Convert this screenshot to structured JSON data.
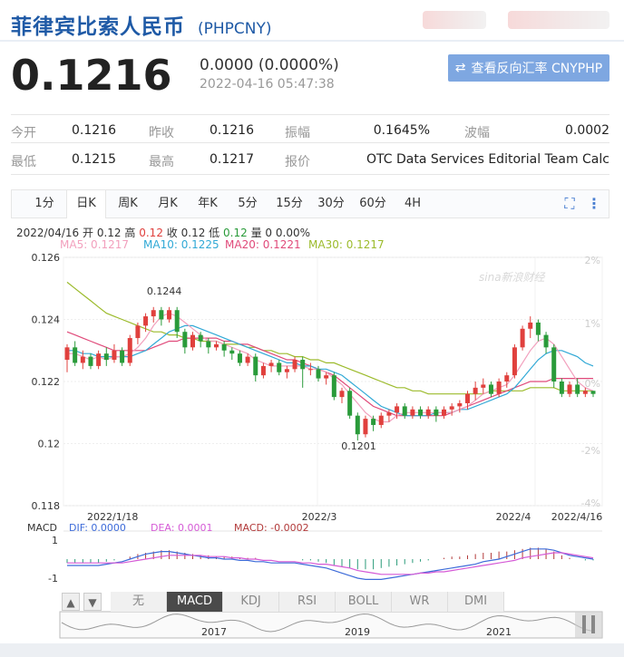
{
  "header": {
    "title": "菲律宾比索人民币",
    "code": "(PHPCNY)"
  },
  "quote": {
    "price": "0.1216",
    "change": "0.0000 (0.0000%)",
    "timestamp": "2022-04-16 05:47:38"
  },
  "reverse_button": {
    "icon": "swap-icon",
    "label": "查看反向汇率 CNYPHP"
  },
  "stats": {
    "open_label": "今开",
    "open": "0.1216",
    "prev_close_label": "昨收",
    "prev_close": "0.1216",
    "amplitude_label": "振幅",
    "amplitude": "0.1645%",
    "wave_label": "波幅",
    "wave": "0.0002",
    "low_label": "最低",
    "low": "0.1215",
    "high_label": "最高",
    "high": "0.1217",
    "quote_label": "报价",
    "quote_source": "OTC Data Services Editorial Team Calc..."
  },
  "tabs": [
    "1分",
    "日K",
    "周K",
    "月K",
    "年K",
    "5分",
    "15分",
    "30分",
    "60分",
    "4H"
  ],
  "active_tab": "日K",
  "ohlc": {
    "date": "2022/04/16",
    "open_label": "开",
    "open": "0.12",
    "high_label": "高",
    "high": "0.12",
    "close_label": "收",
    "close": "0.12",
    "low_label": "低",
    "low": "0.12",
    "vol_label": "量",
    "vol": "0",
    "pct": "0.00%"
  },
  "ma": {
    "ma5": "MA5: 0.1217",
    "ma10": "MA10: 0.1225",
    "ma20": "MA20: 0.1221",
    "ma30": "MA30: 0.1217",
    "colors": {
      "ma5": "#f2a0bd",
      "ma10": "#31a9d6",
      "ma20": "#e04a7a",
      "ma30": "#9cbb2c"
    }
  },
  "watermark": "sina新浪财经",
  "chart_data": {
    "type": "candlestick",
    "y_ticks": [
      "0.126",
      "0.124",
      "0.122",
      "0.12",
      "0.118"
    ],
    "y_right_ticks": [
      "2%",
      "1%",
      "0%",
      "-2%",
      "-4%"
    ],
    "x_labels": [
      "2022/1/18",
      "2022/3",
      "2022/4",
      "2022/4/16"
    ],
    "ylim": [
      0.118,
      0.126
    ],
    "annotations": [
      "0.1244",
      "0.1201"
    ],
    "candles": [
      [
        0.1227,
        0.1231,
        0.1223,
        0.1232
      ],
      [
        0.1231,
        0.1226,
        0.1225,
        0.1233
      ],
      [
        0.1226,
        0.1228,
        0.1224,
        0.123
      ],
      [
        0.1228,
        0.1225,
        0.1224,
        0.1229
      ],
      [
        0.1225,
        0.1229,
        0.1224,
        0.123
      ],
      [
        0.1229,
        0.1227,
        0.1225,
        0.1231
      ],
      [
        0.1227,
        0.123,
        0.1226,
        0.1232
      ],
      [
        0.123,
        0.1226,
        0.1225,
        0.1231
      ],
      [
        0.1226,
        0.1234,
        0.1225,
        0.1235
      ],
      [
        0.1234,
        0.1238,
        0.1232,
        0.1239
      ],
      [
        0.1238,
        0.1241,
        0.1236,
        0.1242
      ],
      [
        0.1241,
        0.1243,
        0.1239,
        0.1244
      ],
      [
        0.1243,
        0.124,
        0.1238,
        0.1244
      ],
      [
        0.124,
        0.1243,
        0.1239,
        0.1244
      ],
      [
        0.1243,
        0.1236,
        0.1234,
        0.1244
      ],
      [
        0.1236,
        0.1231,
        0.1229,
        0.1237
      ],
      [
        0.1231,
        0.1235,
        0.123,
        0.1236
      ],
      [
        0.1235,
        0.1233,
        0.1231,
        0.1236
      ],
      [
        0.1233,
        0.1231,
        0.1229,
        0.1234
      ],
      [
        0.1231,
        0.1232,
        0.123,
        0.1233
      ],
      [
        0.1232,
        0.123,
        0.1228,
        0.1233
      ],
      [
        0.123,
        0.1229,
        0.1227,
        0.1231
      ],
      [
        0.1229,
        0.1226,
        0.1225,
        0.123
      ],
      [
        0.1226,
        0.1228,
        0.1225,
        0.1229
      ],
      [
        0.1228,
        0.1222,
        0.122,
        0.1229
      ],
      [
        0.1222,
        0.1225,
        0.1221,
        0.1226
      ],
      [
        0.1225,
        0.1226,
        0.1223,
        0.1227
      ],
      [
        0.1226,
        0.1223,
        0.1222,
        0.1227
      ],
      [
        0.1223,
        0.1224,
        0.1221,
        0.1225
      ],
      [
        0.1224,
        0.1227,
        0.1223,
        0.1228
      ],
      [
        0.1227,
        0.1224,
        0.1218,
        0.1228
      ],
      [
        0.1224,
        0.1224,
        0.1222,
        0.1226
      ],
      [
        0.1224,
        0.1221,
        0.122,
        0.1225
      ],
      [
        0.1221,
        0.1222,
        0.1219,
        0.1223
      ],
      [
        0.1222,
        0.1215,
        0.1214,
        0.1223
      ],
      [
        0.1215,
        0.1217,
        0.1213,
        0.1218
      ],
      [
        0.1217,
        0.1209,
        0.1208,
        0.1218
      ],
      [
        0.1209,
        0.1203,
        0.1201,
        0.121
      ],
      [
        0.1203,
        0.1208,
        0.1202,
        0.1209
      ],
      [
        0.1208,
        0.1206,
        0.1204,
        0.1209
      ],
      [
        0.1206,
        0.1209,
        0.1205,
        0.121
      ],
      [
        0.1209,
        0.121,
        0.1207,
        0.1211
      ],
      [
        0.121,
        0.1212,
        0.1208,
        0.1213
      ],
      [
        0.1212,
        0.1209,
        0.1208,
        0.1213
      ],
      [
        0.1209,
        0.1211,
        0.1208,
        0.1212
      ],
      [
        0.1211,
        0.1209,
        0.1208,
        0.1212
      ],
      [
        0.1209,
        0.1211,
        0.1208,
        0.1212
      ],
      [
        0.1211,
        0.1209,
        0.1207,
        0.1212
      ],
      [
        0.1209,
        0.1211,
        0.1208,
        0.1212
      ],
      [
        0.1211,
        0.1212,
        0.1209,
        0.1213
      ],
      [
        0.1212,
        0.1213,
        0.121,
        0.1214
      ],
      [
        0.1213,
        0.1216,
        0.1211,
        0.1217
      ],
      [
        0.1216,
        0.1218,
        0.1214,
        0.122
      ],
      [
        0.1218,
        0.1219,
        0.1216,
        0.1221
      ],
      [
        0.1219,
        0.1216,
        0.1215,
        0.122
      ],
      [
        0.1216,
        0.122,
        0.1215,
        0.1221
      ],
      [
        0.122,
        0.1222,
        0.1218,
        0.1223
      ],
      [
        0.1222,
        0.1231,
        0.1221,
        0.1232
      ],
      [
        0.1231,
        0.1237,
        0.123,
        0.1238
      ],
      [
        0.1237,
        0.1239,
        0.1234,
        0.1241
      ],
      [
        0.1239,
        0.1235,
        0.1233,
        0.124
      ],
      [
        0.1235,
        0.1231,
        0.1229,
        0.1236
      ],
      [
        0.1231,
        0.122,
        0.1218,
        0.1232
      ],
      [
        0.122,
        0.1216,
        0.1215,
        0.1221
      ],
      [
        0.1216,
        0.1219,
        0.1215,
        0.122
      ],
      [
        0.1219,
        0.1216,
        0.1215,
        0.1221
      ],
      [
        0.1216,
        0.1217,
        0.1215,
        0.1218
      ],
      [
        0.1217,
        0.1216,
        0.1215,
        0.1217
      ]
    ],
    "ma5": [
      0.1229,
      0.1229,
      0.1228,
      0.1227,
      0.1228,
      0.1227,
      0.1228,
      0.1228,
      0.1229,
      0.1231,
      0.1234,
      0.1238,
      0.1241,
      0.1242,
      0.1241,
      0.1239,
      0.1237,
      0.1235,
      0.1233,
      0.1233,
      0.1232,
      0.1231,
      0.123,
      0.1229,
      0.1227,
      0.1226,
      0.1225,
      0.1225,
      0.1225,
      0.1225,
      0.1225,
      0.1224,
      0.1224,
      0.1223,
      0.1221,
      0.1219,
      0.1216,
      0.1213,
      0.121,
      0.1208,
      0.1207,
      0.1207,
      0.1209,
      0.121,
      0.121,
      0.121,
      0.121,
      0.121,
      0.121,
      0.121,
      0.1211,
      0.1212,
      0.1214,
      0.1216,
      0.1217,
      0.1218,
      0.1219,
      0.1222,
      0.1226,
      0.123,
      0.1233,
      0.1234,
      0.1232,
      0.1228,
      0.1224,
      0.122,
      0.1218,
      0.1217
    ],
    "ma10": [
      0.123,
      0.123,
      0.1229,
      0.1229,
      0.1228,
      0.1228,
      0.1228,
      0.1228,
      0.1228,
      0.1229,
      0.123,
      0.1232,
      0.1234,
      0.1236,
      0.1237,
      0.1238,
      0.1238,
      0.1237,
      0.1236,
      0.1235,
      0.1234,
      0.1233,
      0.1232,
      0.1231,
      0.123,
      0.1229,
      0.1228,
      0.1227,
      0.1226,
      0.1226,
      0.1225,
      0.1225,
      0.1224,
      0.1224,
      0.1223,
      0.1222,
      0.122,
      0.1218,
      0.1216,
      0.1214,
      0.1212,
      0.1211,
      0.121,
      0.1209,
      0.1209,
      0.1209,
      0.1209,
      0.121,
      0.121,
      0.121,
      0.1211,
      0.1211,
      0.1212,
      0.1213,
      0.1214,
      0.1215,
      0.1216,
      0.1218,
      0.1221,
      0.1224,
      0.1227,
      0.1229,
      0.123,
      0.123,
      0.1229,
      0.1228,
      0.1226,
      0.1225
    ],
    "ma20": [
      0.1236,
      0.1235,
      0.1234,
      0.1233,
      0.1232,
      0.1231,
      0.123,
      0.123,
      0.123,
      0.123,
      0.123,
      0.1231,
      0.1232,
      0.1233,
      0.1233,
      0.1234,
      0.1234,
      0.1234,
      0.1234,
      0.1234,
      0.1233,
      0.1233,
      0.1232,
      0.1232,
      0.1231,
      0.123,
      0.1229,
      0.1228,
      0.1227,
      0.1227,
      0.1226,
      0.1225,
      0.1224,
      0.1223,
      0.1222,
      0.122,
      0.1218,
      0.1216,
      0.1214,
      0.1212,
      0.1211,
      0.121,
      0.1209,
      0.1209,
      0.1209,
      0.1209,
      0.1209,
      0.1209,
      0.1209,
      0.121,
      0.1211,
      0.1212,
      0.1213,
      0.1214,
      0.1215,
      0.1216,
      0.1217,
      0.1218,
      0.1219,
      0.122,
      0.122,
      0.122,
      0.1221,
      0.1221,
      0.1221,
      0.1221,
      0.1221,
      0.1221
    ],
    "ma30": [
      0.1252,
      0.125,
      0.1248,
      0.1246,
      0.1244,
      0.1242,
      0.1241,
      0.124,
      0.1239,
      0.1238,
      0.1237,
      0.1236,
      0.1236,
      0.1235,
      0.1235,
      0.1234,
      0.1234,
      0.1233,
      0.1233,
      0.1233,
      0.1232,
      0.1232,
      0.1232,
      0.1231,
      0.1231,
      0.123,
      0.123,
      0.1229,
      0.1229,
      0.1228,
      0.1228,
      0.1227,
      0.1227,
      0.1226,
      0.1226,
      0.1225,
      0.1224,
      0.1223,
      0.1222,
      0.1221,
      0.122,
      0.1219,
      0.1218,
      0.1218,
      0.1217,
      0.1217,
      0.1216,
      0.1216,
      0.1216,
      0.1216,
      0.1216,
      0.1216,
      0.1216,
      0.1216,
      0.1217,
      0.1217,
      0.1217,
      0.1217,
      0.1217,
      0.1218,
      0.1218,
      0.1218,
      0.1218,
      0.1217,
      0.1217,
      0.1217,
      0.1217,
      0.1217
    ]
  },
  "macd": {
    "dif_label": "DIF: 0.0000",
    "dea_label": "DEA: 0.0001",
    "macd_label": "MACD: -0.0002",
    "title": "MACD",
    "y_ticks": [
      "1",
      "-1"
    ],
    "hist": [
      -0.3,
      -0.3,
      -0.3,
      -0.3,
      -0.3,
      -0.2,
      -0.1,
      0.0,
      0.2,
      0.4,
      0.5,
      0.6,
      0.7,
      0.7,
      0.6,
      0.5,
      0.4,
      0.3,
      0.3,
      0.2,
      0.2,
      0.2,
      0.1,
      0.1,
      0.1,
      0.0,
      0.0,
      0.0,
      0.0,
      0.0,
      -0.1,
      -0.1,
      -0.2,
      -0.3,
      -0.5,
      -0.6,
      -0.7,
      -0.8,
      -0.8,
      -0.8,
      -0.7,
      -0.6,
      -0.5,
      -0.4,
      -0.3,
      -0.2,
      -0.1,
      0.0,
      0.1,
      0.2,
      0.2,
      0.3,
      0.4,
      0.5,
      0.5,
      0.6,
      0.6,
      0.7,
      0.8,
      0.9,
      0.9,
      0.8,
      0.6,
      0.3,
      0.1,
      0.0,
      -0.1,
      -0.1
    ],
    "dif": [
      -0.5,
      -0.5,
      -0.5,
      -0.5,
      -0.5,
      -0.4,
      -0.3,
      -0.2,
      0.0,
      0.2,
      0.4,
      0.5,
      0.6,
      0.6,
      0.5,
      0.4,
      0.3,
      0.2,
      0.1,
      0.1,
      0.0,
      0.0,
      -0.1,
      -0.1,
      -0.2,
      -0.2,
      -0.3,
      -0.3,
      -0.3,
      -0.3,
      -0.4,
      -0.5,
      -0.6,
      -0.7,
      -0.9,
      -1.1,
      -1.3,
      -1.5,
      -1.6,
      -1.6,
      -1.6,
      -1.5,
      -1.4,
      -1.3,
      -1.2,
      -1.1,
      -1.0,
      -0.9,
      -0.8,
      -0.7,
      -0.6,
      -0.5,
      -0.4,
      -0.2,
      -0.1,
      0.0,
      0.2,
      0.4,
      0.6,
      0.8,
      0.8,
      0.8,
      0.7,
      0.5,
      0.3,
      0.2,
      0.1,
      0.0
    ],
    "dea": [
      -0.3,
      -0.3,
      -0.3,
      -0.3,
      -0.3,
      -0.3,
      -0.3,
      -0.3,
      -0.2,
      -0.1,
      0.0,
      0.1,
      0.2,
      0.3,
      0.3,
      0.3,
      0.3,
      0.3,
      0.2,
      0.2,
      0.2,
      0.1,
      0.1,
      0.0,
      0.0,
      -0.1,
      -0.1,
      -0.2,
      -0.2,
      -0.2,
      -0.3,
      -0.3,
      -0.4,
      -0.4,
      -0.5,
      -0.6,
      -0.7,
      -0.9,
      -1.0,
      -1.1,
      -1.2,
      -1.2,
      -1.2,
      -1.2,
      -1.2,
      -1.1,
      -1.1,
      -1.0,
      -1.0,
      -0.9,
      -0.8,
      -0.7,
      -0.6,
      -0.5,
      -0.4,
      -0.3,
      -0.2,
      -0.1,
      0.1,
      0.2,
      0.3,
      0.4,
      0.5,
      0.5,
      0.4,
      0.3,
      0.2,
      0.1
    ]
  },
  "lower_buttons": {
    "up": "▲",
    "down": "▼"
  },
  "indicators": [
    "无",
    "MACD",
    "KDJ",
    "RSI",
    "BOLL",
    "WR",
    "DMI"
  ],
  "active_indicator": "MACD",
  "navigator": {
    "years": [
      "2017",
      "2019",
      "2021"
    ]
  }
}
